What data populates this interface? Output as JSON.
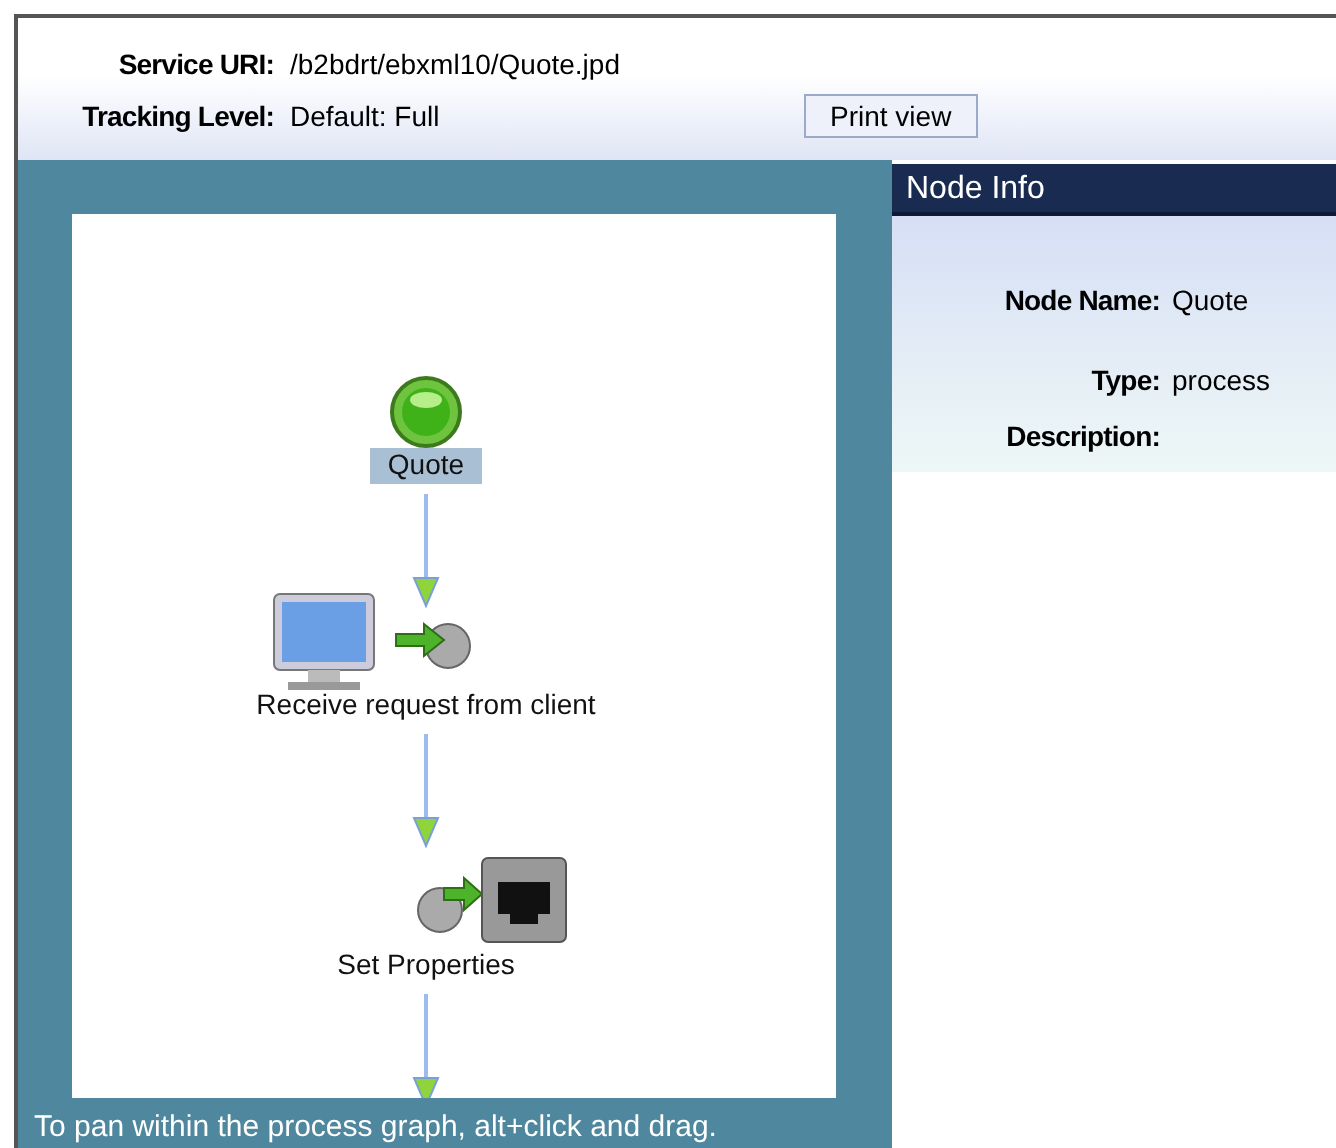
{
  "header": {
    "fields": [
      {
        "label": "Service URI:",
        "value": "/b2bdrt/ebxml10/Quote.jpd"
      },
      {
        "label": "Tracking Level:",
        "value": "Default: Full"
      }
    ],
    "print_button": "Print view"
  },
  "graph": {
    "nodes": [
      {
        "kind": "start",
        "label": "Quote",
        "selected": true
      },
      {
        "kind": "receive",
        "label": "Receive request from client",
        "selected": false
      },
      {
        "kind": "set",
        "label": "Set Properties",
        "selected": false
      }
    ],
    "hint": "To pan within the process graph, alt+click and drag."
  },
  "node_info": {
    "title": "Node Info",
    "rows": [
      {
        "label": "Node Name:",
        "value": "Quote"
      },
      {
        "label": "Type:",
        "value": "process"
      },
      {
        "label": "Description:",
        "value": ""
      }
    ]
  }
}
